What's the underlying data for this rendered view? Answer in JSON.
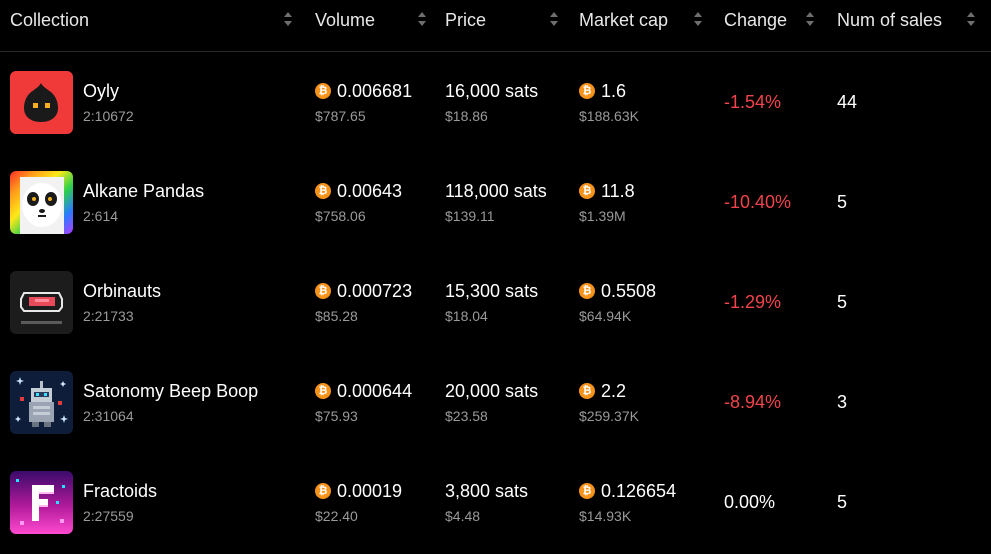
{
  "colors": {
    "negative": "#f0444b",
    "muted": "#9a9a9a",
    "bitcoin": "#f7931a",
    "background": "#000000"
  },
  "header": {
    "collection": "Collection",
    "volume": "Volume",
    "price": "Price",
    "market_cap": "Market cap",
    "change": "Change",
    "num_sales": "Num of sales"
  },
  "icons": {
    "sort": "sort-updown-icon",
    "coin": "bitcoin-icon",
    "coin_glyph": "₿"
  },
  "rows": [
    {
      "name": "Oyly",
      "id": "2:10672",
      "volume": "0.006681",
      "volume_usd": "$787.65",
      "price": "16,000 sats",
      "price_usd": "$18.86",
      "market_cap": "1.6",
      "market_cap_usd": "$188.63K",
      "change": "-1.54%",
      "sales": "44"
    },
    {
      "name": "Alkane Pandas",
      "id": "2:614",
      "volume": "0.00643",
      "volume_usd": "$758.06",
      "price": "118,000 sats",
      "price_usd": "$139.11",
      "market_cap": "11.8",
      "market_cap_usd": "$1.39M",
      "change": "-10.40%",
      "sales": "5"
    },
    {
      "name": "Orbinauts",
      "id": "2:21733",
      "volume": "0.000723",
      "volume_usd": "$85.28",
      "price": "15,300 sats",
      "price_usd": "$18.04",
      "market_cap": "0.5508",
      "market_cap_usd": "$64.94K",
      "change": "-1.29%",
      "sales": "5"
    },
    {
      "name": "Satonomy Beep Boop",
      "id": "2:31064",
      "volume": "0.000644",
      "volume_usd": "$75.93",
      "price": "20,000 sats",
      "price_usd": "$23.58",
      "market_cap": "2.2",
      "market_cap_usd": "$259.37K",
      "change": "-8.94%",
      "sales": "3"
    },
    {
      "name": "Fractoids",
      "id": "2:27559",
      "volume": "0.00019",
      "volume_usd": "$22.40",
      "price": "3,800 sats",
      "price_usd": "$4.48",
      "market_cap": "0.126654",
      "market_cap_usd": "$14.93K",
      "change": "0.00%",
      "sales": "5"
    }
  ]
}
